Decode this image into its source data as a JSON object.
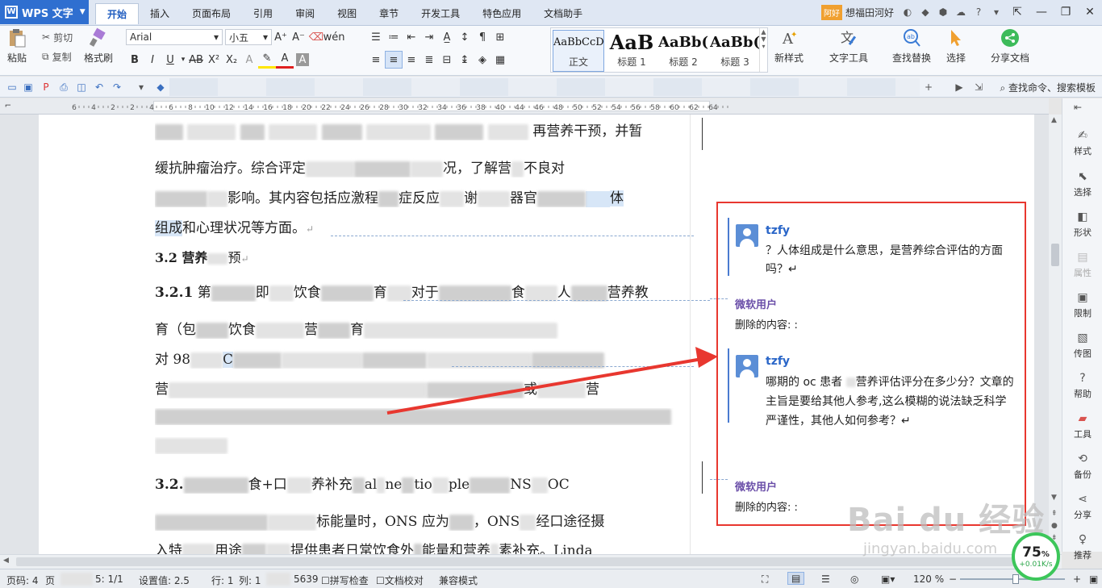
{
  "titlebar": {
    "app_name": "WPS 文字",
    "tabs": [
      "开始",
      "插入",
      "页面布局",
      "引用",
      "审阅",
      "视图",
      "章节",
      "开发工具",
      "特色应用",
      "文档助手"
    ],
    "user_badge": "阿好",
    "user_name": "想福田河好"
  },
  "ribbon": {
    "paste": "粘贴",
    "cut": "剪切",
    "copy": "复制",
    "format_painter": "格式刷",
    "font_name": "Arial",
    "font_size": "小五",
    "styles": [
      {
        "preview": "AaBbCcD",
        "name": "正文"
      },
      {
        "preview": "AaB",
        "name": "标题 1"
      },
      {
        "preview": "AaBb(",
        "name": "标题 2"
      },
      {
        "preview": "AaBb(",
        "name": "标题 3"
      }
    ],
    "new_style": "新样式",
    "text_tools": "文字工具",
    "find_replace": "查找替换",
    "select": "选择",
    "share_doc": "分享文档"
  },
  "quickbar": {
    "search_cmd": "查找命令、搜索模板"
  },
  "ruler": {
    "ticks": [
      "6",
      "4",
      "2",
      "2",
      "4",
      "6",
      "8",
      "10",
      "12",
      "14",
      "16",
      "18",
      "20",
      "22",
      "24",
      "26",
      "28",
      "30",
      "32",
      "34",
      "36",
      "38",
      "40",
      "44",
      "46",
      "48",
      "50",
      "52",
      "54",
      "56",
      "58",
      "60",
      "62",
      "64"
    ]
  },
  "document": {
    "lines": [
      "再营养干预，并暂",
      "缓抗肿瘤治疗。综合评定",
      "况，了解营",
      "不良对",
      "影响。其内容包括应激程",
      "症反应",
      "谢",
      "器官",
      "体",
      "组成",
      "和心理状况等方面。",
      "3.2",
      "营养",
      "预",
      "3.2.1",
      "第",
      "即",
      "饮食",
      "育",
      "对于",
      "食",
      "人",
      "营养教",
      "育（包",
      "饮食",
      "营",
      "育",
      "对 98",
      "C",
      "营",
      "或",
      "营",
      "3.2.",
      "食+口",
      "养补充",
      "al",
      "ne",
      "tio",
      "ple",
      "NS",
      "OC",
      "标能量时，ONS 应为",
      "，ONS",
      "经口途径摄",
      "入特",
      "用途",
      "提供患者日常饮食外",
      "能量和营养",
      "素补充。Linda"
    ]
  },
  "comments": [
    {
      "author": "tzfy",
      "text": "？人体组成是什么意思，是营养综合评估的方面吗？↵"
    },
    {
      "reviser": "微软用户",
      "deleted": "删除的内容: :"
    },
    {
      "author": "tzfy",
      "text": "哪期的 oc 患者",
      "text2": "营养评估评分在多少分？文章的主旨是要给其他人参考,这么模糊的说法缺乏科学严谨性，其他人如何参考？↵"
    },
    {
      "reviser": "微软用户",
      "deleted": "删除的内容: :"
    }
  ],
  "sidebar": [
    "样式",
    "选择",
    "形状",
    "属性",
    "限制",
    "传图",
    "帮助",
    "工具",
    "备份",
    "分享",
    "推荐"
  ],
  "statusbar": {
    "page": "页码: 4",
    "page_label": "页",
    "sections": "5: 1/1",
    "settings": "设置值: 2.5",
    "row": "行: 1",
    "col": "列: 1",
    "words": "5639",
    "spell": "拼写检查",
    "proof": "文档校对",
    "compat": "兼容模式",
    "zoom": "120 %"
  },
  "speed_widget": {
    "percent": "75",
    "unit": "%",
    "rate": "+0.01K/s"
  },
  "watermark": {
    "logo": "Bai du 经验",
    "url": "jingyan.baidu.com"
  }
}
